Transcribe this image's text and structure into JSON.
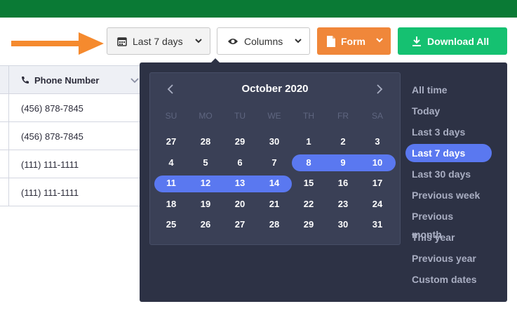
{
  "toolbar": {
    "date_label": "Last 7 days",
    "columns_label": "Columns",
    "form_label": "Form",
    "download_label": "Download All"
  },
  "table": {
    "header": "Phone Number",
    "rows": [
      "(456) 878-7845",
      "(456) 878-7845",
      "(111) 111-1111",
      "(111) 111-1111"
    ]
  },
  "calendar": {
    "month_label": "October 2020",
    "weekdays": [
      "SU",
      "MO",
      "TU",
      "WE",
      "TH",
      "FR",
      "SA"
    ],
    "weeks": [
      [
        "27",
        "28",
        "29",
        "30",
        "1",
        "2",
        "3"
      ],
      [
        "4",
        "5",
        "6",
        "7",
        "8",
        "9",
        "10"
      ],
      [
        "11",
        "12",
        "13",
        "14",
        "15",
        "16",
        "17"
      ],
      [
        "18",
        "19",
        "20",
        "21",
        "22",
        "23",
        "24"
      ],
      [
        "25",
        "26",
        "27",
        "28",
        "29",
        "30",
        "31"
      ]
    ],
    "selected_start": "8",
    "selected_end": "14"
  },
  "ranges": {
    "items": [
      "All time",
      "Today",
      "Last 3 days",
      "Last 7 days",
      "Last 30 days",
      "Previous week",
      "Previous month",
      "This year",
      "Previous year",
      "Custom dates"
    ],
    "active": "Last 7 days"
  },
  "colors": {
    "topbar": "#0a7a35",
    "arrow": "#f58a2e",
    "form_button": "#f0873a",
    "download_button": "#15c171",
    "panel": "#2d3245",
    "selection": "#5a78f0"
  },
  "icons": {
    "date": "calendar-icon",
    "columns": "eye-icon",
    "form": "document-icon",
    "download": "download-icon",
    "phone": "phone-icon",
    "prev": "chevron-left-icon",
    "next": "chevron-right-icon"
  }
}
